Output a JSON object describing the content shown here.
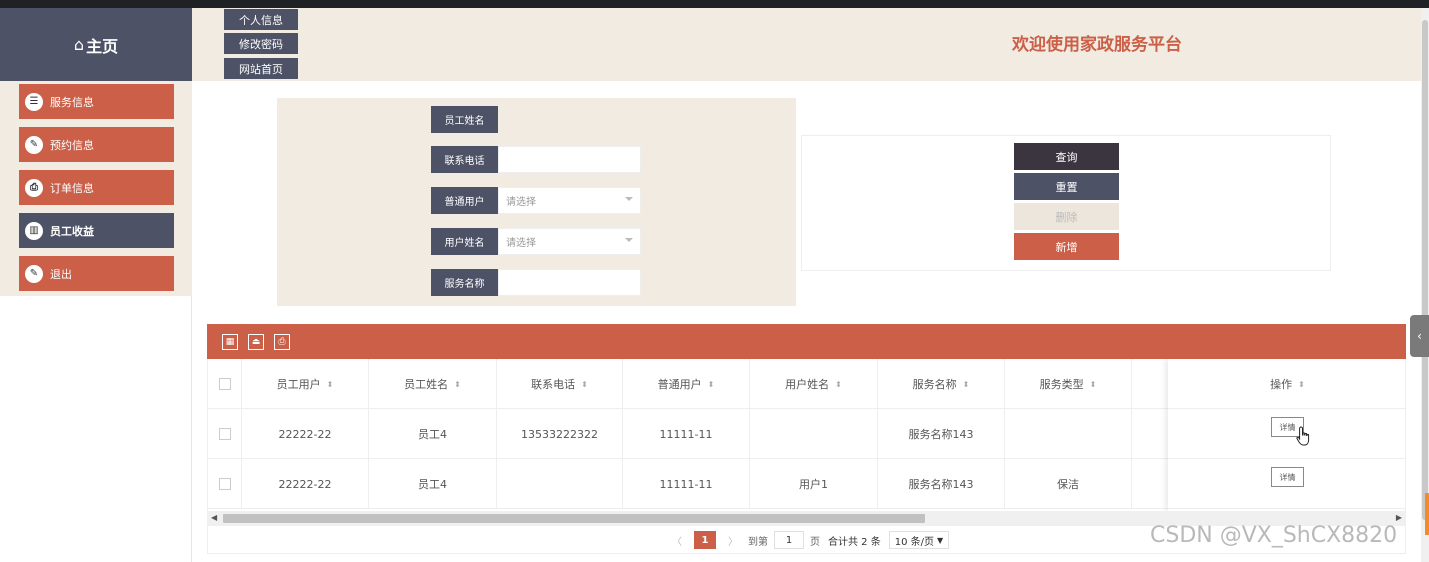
{
  "sidebar": {
    "home_label": "主页",
    "home_glyph": "⌂",
    "items": [
      {
        "label": "服务信息",
        "icon": "list-icon",
        "glyph": "☰",
        "active": false
      },
      {
        "label": "预约信息",
        "icon": "edit-icon",
        "glyph": "✎",
        "active": false
      },
      {
        "label": "订单信息",
        "icon": "print-icon",
        "glyph": "⎙",
        "active": false
      },
      {
        "label": "员工收益",
        "icon": "chart-icon",
        "glyph": "▥",
        "active": true
      },
      {
        "label": "退出",
        "icon": "edit-icon",
        "glyph": "✎",
        "active": false
      }
    ]
  },
  "header": {
    "buttons": [
      "个人信息",
      "修改密码",
      "网站首页"
    ],
    "welcome": "欢迎使用家政服务平台"
  },
  "search": {
    "fields": [
      {
        "label": "员工姓名",
        "value": "",
        "placeholder": "",
        "type": "none"
      },
      {
        "label": "联系电话",
        "value": "",
        "placeholder": "",
        "type": "input"
      },
      {
        "label": "普通用户",
        "value": "请选择",
        "placeholder": "请选择",
        "type": "select"
      },
      {
        "label": "用户姓名",
        "value": "请选择",
        "placeholder": "请选择",
        "type": "select"
      },
      {
        "label": "服务名称",
        "value": "",
        "placeholder": "",
        "type": "input"
      }
    ]
  },
  "actions": {
    "query": "查询",
    "reset": "重置",
    "delete": "删除",
    "add": "新增"
  },
  "colors": {
    "accent": "#cb5f48",
    "dark": "#4e5266",
    "panel": "#f1ebe1",
    "query_bg": "#3b3540",
    "delete_bg": "#ede6dc"
  },
  "table": {
    "toolbar_icons": [
      "export-icon",
      "import-icon",
      "print-icon"
    ],
    "columns": [
      "员工用户",
      "员工姓名",
      "联系电话",
      "普通用户",
      "用户姓名",
      "服务名称",
      "服务类型"
    ],
    "operation_header": "操作",
    "rows": [
      [
        "22222-22",
        "员工4",
        "13533222322",
        "11111-11",
        "",
        "服务名称143",
        ""
      ],
      [
        "22222-22",
        "员工4",
        "",
        "11111-11",
        "用户1",
        "服务名称143",
        "保洁"
      ]
    ],
    "detail_label": "详情"
  },
  "pager": {
    "prev": "〈",
    "current": "1",
    "next": "〉",
    "goto_label": "到第",
    "goto_value": "1",
    "page_label": "页",
    "total_text": "合计共 2 条",
    "page_size": "10 条/页"
  },
  "watermark": "CSDN @VX_ShCX8820"
}
